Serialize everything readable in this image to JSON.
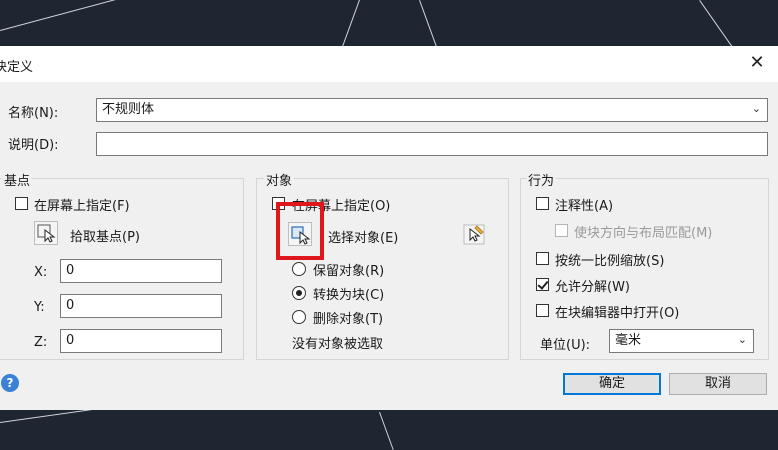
{
  "dialog": {
    "title": "块定义",
    "close_glyph": "✕",
    "name_label": "名称(N):",
    "name_value": "不规则体",
    "desc_label": "说明(D):",
    "desc_value": ""
  },
  "basepoint": {
    "title": "基点",
    "specify_on_screen": "在屏幕上指定(F)",
    "pick_label": "拾取基点(P)",
    "x_label": "X:",
    "x_value": "0",
    "y_label": "Y:",
    "y_value": "0",
    "z_label": "Z:",
    "z_value": "0"
  },
  "objects": {
    "title": "对象",
    "specify_on_screen": "在屏幕上指定(O)",
    "select_label": "选择对象(E)",
    "retain": "保留对象(R)",
    "convert": "转换为块(C)",
    "delete": "删除对象(T)",
    "status": "没有对象被选取"
  },
  "behavior": {
    "title": "行为",
    "annotative": "注释性(A)",
    "match_orientation": "使块方向与布局匹配(M)",
    "scale_uniformly": "按统一比例缩放(S)",
    "allow_explode": "允许分解(W)",
    "open_in_editor": "在块编辑器中打开(O)",
    "unit_label": "单位(U):",
    "unit_value": "毫米"
  },
  "buttons": {
    "ok": "确定",
    "cancel": "取消",
    "help": "?"
  }
}
